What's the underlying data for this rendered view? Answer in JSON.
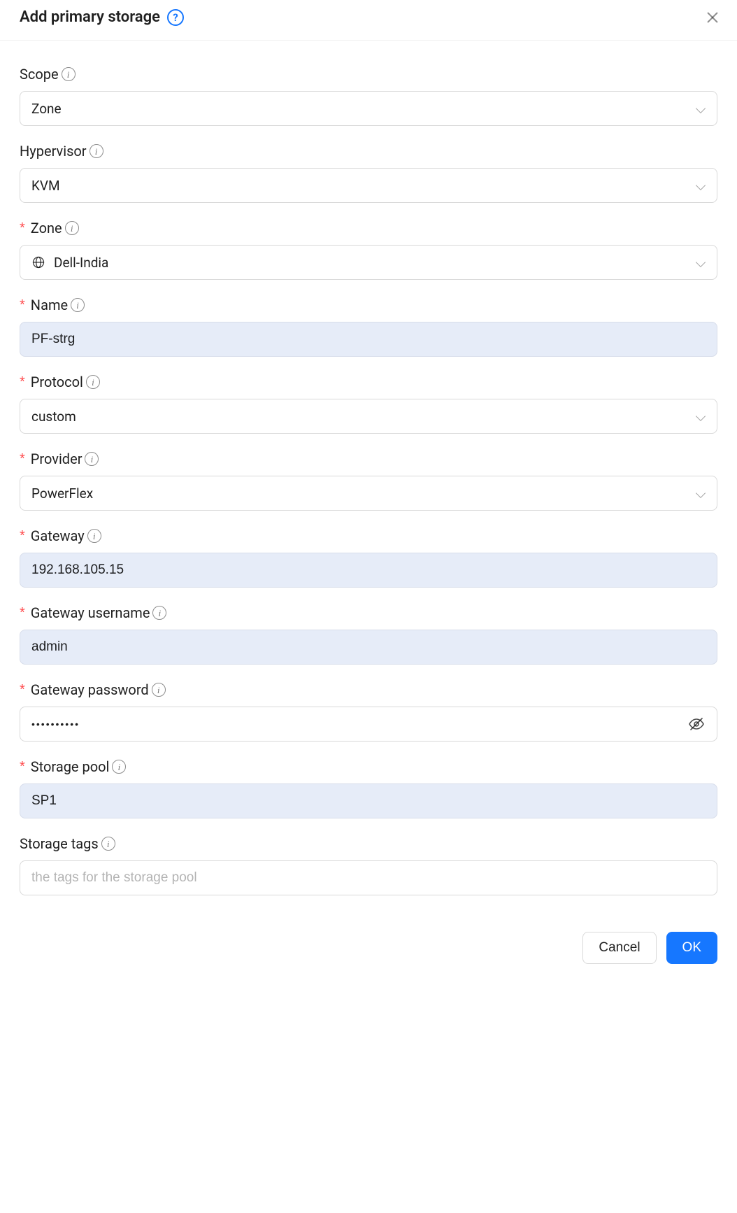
{
  "modal": {
    "title": "Add primary storage"
  },
  "form": {
    "scope": {
      "label": "Scope",
      "value": "Zone",
      "required": false
    },
    "hypervisor": {
      "label": "Hypervisor",
      "value": "KVM",
      "required": false
    },
    "zone": {
      "label": "Zone",
      "value": "Dell-India",
      "required": true
    },
    "name": {
      "label": "Name",
      "value": "PF-strg",
      "required": true
    },
    "protocol": {
      "label": "Protocol",
      "value": "custom",
      "required": true
    },
    "provider": {
      "label": "Provider",
      "value": "PowerFlex",
      "required": true
    },
    "gateway": {
      "label": "Gateway",
      "value": "192.168.105.15",
      "required": true
    },
    "gateway_username": {
      "label": "Gateway username",
      "value": "admin",
      "required": true
    },
    "gateway_password": {
      "label": "Gateway password",
      "value": "••••••••••",
      "required": true
    },
    "storage_pool": {
      "label": "Storage pool",
      "value": "SP1",
      "required": true
    },
    "storage_tags": {
      "label": "Storage tags",
      "placeholder": "the tags for the storage pool",
      "value": "",
      "required": false
    }
  },
  "buttons": {
    "cancel": "Cancel",
    "ok": "OK"
  }
}
